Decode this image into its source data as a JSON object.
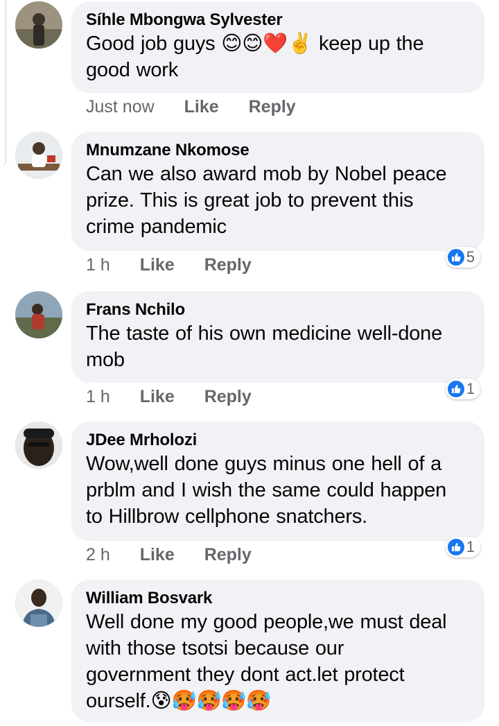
{
  "comments": [
    {
      "name": "Síhle Mbongwa Sylvester",
      "text_lines": [
        "Good job guys 😊😊❤️✌️ keep up the",
        "good work"
      ],
      "time": "Just now",
      "like_label": "Like",
      "reply_label": "Reply",
      "reaction_count": null
    },
    {
      "name": "Mnumzane Nkomose",
      "text_lines": [
        "Can we also award mob by  Nobel peace",
        "prize. This is great job to prevent this",
        "crime pandemic"
      ],
      "time": "1 h",
      "like_label": "Like",
      "reply_label": "Reply",
      "reaction_count": "5"
    },
    {
      "name": "Frans Nchilo",
      "text_lines": [
        "The taste of his own medicine well-done",
        "mob"
      ],
      "time": "1 h",
      "like_label": "Like",
      "reply_label": "Reply",
      "reaction_count": "1"
    },
    {
      "name": "JDee Mrholozi",
      "text_lines": [
        "Wow,well done guys minus one hell of a",
        "prblm and I wish the same could happen",
        "to Hillbrow cellphone snatchers."
      ],
      "time": "2 h",
      "like_label": "Like",
      "reply_label": "Reply",
      "reaction_count": "1"
    },
    {
      "name": "William Bosvark",
      "text_lines": [
        "Well done my good people,we must deal",
        "with those tsotsi because our",
        "government they dont act.let protect",
        "ourself.😰🥵🥵🥵🥵"
      ],
      "time": null,
      "like_label": null,
      "reply_label": null,
      "reaction_count": null
    }
  ],
  "colors": {
    "bubble": "#f0f2f5",
    "action_text": "#65676b",
    "like_blue": "#1877f2"
  },
  "icons": {
    "like": "thumbs-up-icon"
  }
}
